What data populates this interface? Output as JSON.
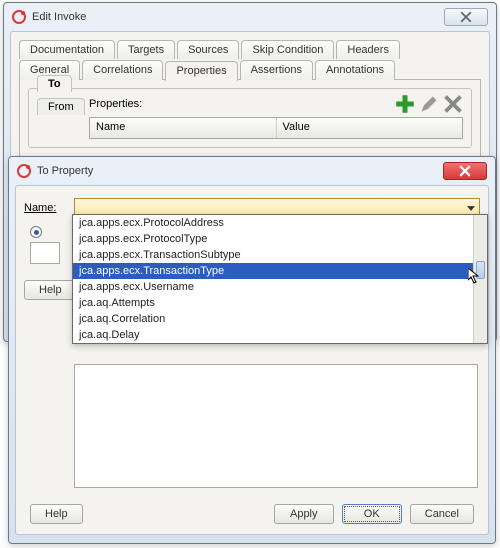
{
  "edit_dialog": {
    "title": "Edit Invoke",
    "tabs_row1": [
      "Documentation",
      "Targets",
      "Sources",
      "Skip Condition",
      "Headers"
    ],
    "tabs_row2": [
      "General",
      "Correlations",
      "Properties",
      "Assertions",
      "Annotations"
    ],
    "active_tab": "Properties",
    "tofrom": {
      "to_label": "To",
      "from_label": "From"
    },
    "properties_label": "Properties:",
    "table_headers": [
      "Name",
      "Value"
    ],
    "help_label": "Help"
  },
  "to_property_dialog": {
    "title": "To Property",
    "name_label": "Name:",
    "dropdown_items": [
      "jca.apps.ecx.ProtocolAddress",
      "jca.apps.ecx.ProtocolType",
      "jca.apps.ecx.TransactionSubtype",
      "jca.apps.ecx.TransactionType",
      "jca.apps.ecx.Username",
      "jca.aq.Attempts",
      "jca.aq.Correlation",
      "jca.aq.Delay"
    ],
    "selected_item": "jca.apps.ecx.TransactionType",
    "help_label": "Help",
    "buttons": [
      "Apply",
      "OK",
      "Cancel"
    ],
    "focused_button": "OK"
  }
}
